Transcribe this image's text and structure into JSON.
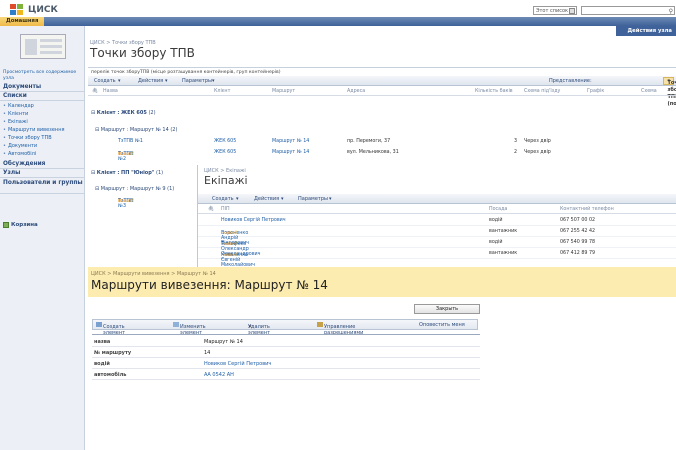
{
  "header": {
    "logo_text": "ЦИСК",
    "home_tab": "Домашняя",
    "scope": "Этот список",
    "site_actions": "Действия узла"
  },
  "leftnav": {
    "all_content": "Просмотреть все содержимое узла",
    "documents_head": "Документы",
    "lists_head": "Списки",
    "lists": [
      "Календар",
      "Клієнти",
      "Екіпажі",
      "Маршрути вивезення",
      "Точки збору ТПВ",
      "Документи",
      "Автомобілі"
    ],
    "discussions_head": "Обсуждения",
    "sites_head": "Узлы",
    "people_head": "Пользователи и группы",
    "recycle": "Корзина"
  },
  "main": {
    "breadcrumb": "ЦИСК > Точки збору ТПВ",
    "title": "Точки збору ТПВ",
    "view_desc": "перелік точок зборуТПВ (місце розташування контейнерів, груп контейнерів)",
    "toolbar": {
      "new": "Создать",
      "actions": "Действия",
      "settings": "Параметры",
      "view_label": "Представление:",
      "view_value": "Точки збору ТПВ (по ..."
    },
    "columns": {
      "name": "Назва",
      "client": "Клієнт",
      "route": "Маршрут",
      "address": "Адреса",
      "count": "Кількість баків",
      "scheme": "Схема під'їзду",
      "graph": "Графік",
      "scheme2": "Схема"
    },
    "group1": "Клієнт : ЖЕК 605",
    "group1_count": "(2)",
    "subgroup1": "Маршрут : Маршрут № 14",
    "subgroup1_count": "(2)",
    "rows": [
      {
        "name": "ТзТПВ №1",
        "new": "",
        "client": "ЖЕК 605",
        "route": "Маршрут № 14",
        "address": "пр. Перемоги, 37",
        "count": "3",
        "scheme": "Через двір"
      },
      {
        "name": "ТзТПВ №2",
        "new": "Новое",
        "client": "ЖЕК 605",
        "route": "Маршрут № 14",
        "address": "вул. Мельникова, 31",
        "count": "2",
        "scheme": "Через двір"
      }
    ],
    "group2": "Клієнт : ПП \"Юніор\"",
    "group2_count": "(1)",
    "subgroup2": "Маршрут : Маршрут № 9",
    "subgroup2_count": "(1)",
    "row3_name": "ТзТПВ №3",
    "row3_new": "Новое"
  },
  "overlay": {
    "breadcrumb": "ЦИСК > Екіпажі",
    "title": "Екіпажі",
    "toolbar": {
      "new": "Создать",
      "actions": "Действия",
      "settings": "Параметры"
    },
    "columns": {
      "name": "ПІП",
      "position": "Посада",
      "phone": "Контактний телефон"
    },
    "rows": [
      {
        "name": "Новиков Сергій Петрович",
        "new": "",
        "position": "водій",
        "phone": "067 507 00 02"
      },
      {
        "name": "Вороненко Андрій Вікторович",
        "new": "Новое",
        "position": "вантажник",
        "phone": "067 255 42 42"
      },
      {
        "name": "Тимофеєв Олександр Олександрович",
        "new": "Новое",
        "position": "водій",
        "phone": "067 540 99 78"
      },
      {
        "name": "Коваленко Євгеній Миколайович",
        "new": "Новое",
        "position": "вантажник",
        "phone": "067 412 89 79"
      }
    ]
  },
  "form": {
    "breadcrumb": "ЦИСК > Маршрути вивезення > Маршрут № 14",
    "title": "Маршрути вивезення: Маршрут № 14",
    "close": "Закрыть",
    "toolbar": {
      "new_item": "Создать элемент",
      "edit_item": "Изменить элемент",
      "delete_item": "Удалить элемент",
      "permissions": "Управление разрешениями",
      "alert": "Оповестить меня"
    },
    "fields": [
      {
        "label": "назва",
        "value": "Маршрут № 14"
      },
      {
        "label": "№ маршруту",
        "value": "14"
      },
      {
        "label": "водій",
        "value": "Новиков Сергій Петрович"
      },
      {
        "label": "автомобіль",
        "value": "АА 0542 АН"
      }
    ]
  }
}
